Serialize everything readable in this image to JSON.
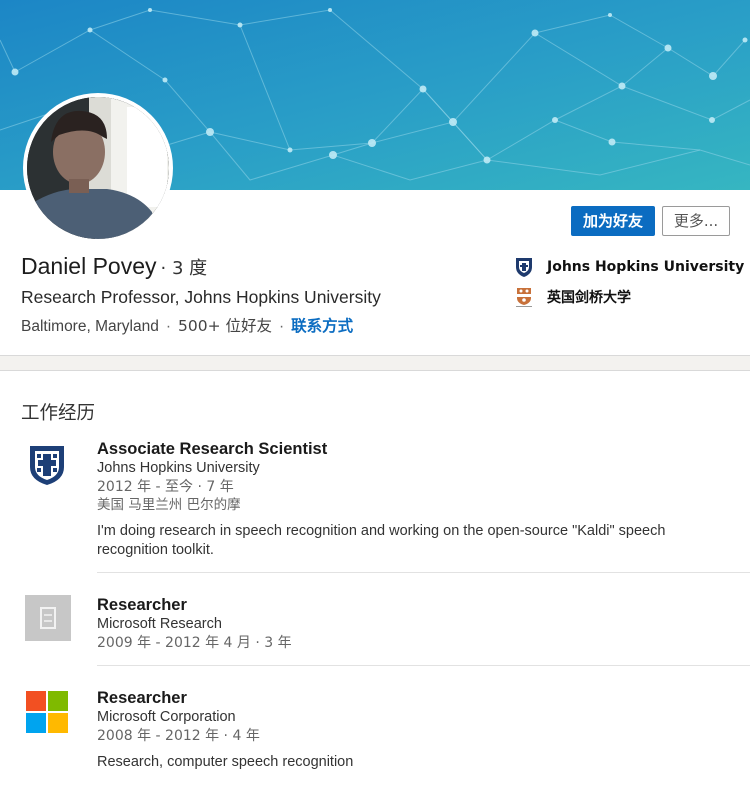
{
  "profile": {
    "name": "Daniel Povey",
    "degree": "· 3 度",
    "headline": "Research Professor, Johns Hopkins University",
    "location": "Baltimore, Maryland",
    "connections": "500+ 位好友",
    "contact_link": "联系方式",
    "separator": "·"
  },
  "actions": {
    "connect_label": "加为好友",
    "more_label": "更多..."
  },
  "education": [
    {
      "label": "Johns Hopkins University",
      "icon": "jhu-shield-icon"
    },
    {
      "label": "英国剑桥大学",
      "icon": "cambridge-crest-icon"
    }
  ],
  "experience": {
    "section_title": "工作经历",
    "items": [
      {
        "title": "Associate Research Scientist",
        "company": "Johns Hopkins University",
        "dates": "2012 年 - 至今 · 7 年",
        "location": "美国 马里兰州 巴尔的摩",
        "description": "I'm doing research in speech recognition and working on the open-source \"Kaldi\" speech recognition toolkit.",
        "icon": "jhu-logo-icon"
      },
      {
        "title": "Researcher",
        "company": "Microsoft Research",
        "dates": "2009 年 - 2012 年 4 月 · 3 年",
        "icon": "placeholder-company-icon"
      },
      {
        "title": "Researcher",
        "company": "Microsoft Corporation",
        "dates": "2008 年 - 2012 年 · 4 年",
        "description": "Research, computer speech recognition",
        "icon": "microsoft-logo-icon"
      }
    ]
  },
  "colors": {
    "brand_blue": "#0b6cc1",
    "banner_start": "#1f8fc9",
    "banner_end": "#33b2c0"
  }
}
